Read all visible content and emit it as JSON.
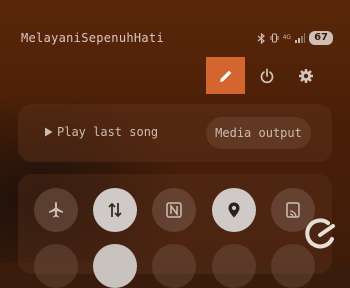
{
  "status_bar": {
    "carrier": "MelayaniSepenuhHati",
    "network_type": "4G",
    "battery": "67"
  },
  "media": {
    "play_last_song": "Play last song",
    "media_output": "Media output"
  },
  "icons": {
    "edit": "pencil-icon",
    "power": "power-icon",
    "settings": "gear-icon",
    "tiles": [
      "airplane-icon",
      "mobile-data-icon",
      "nfc-icon",
      "location-icon",
      "cast-icon"
    ]
  },
  "colors": {
    "accent": "#d5652e",
    "background": "#4a1f08",
    "tile_active": "#cfcac7"
  }
}
